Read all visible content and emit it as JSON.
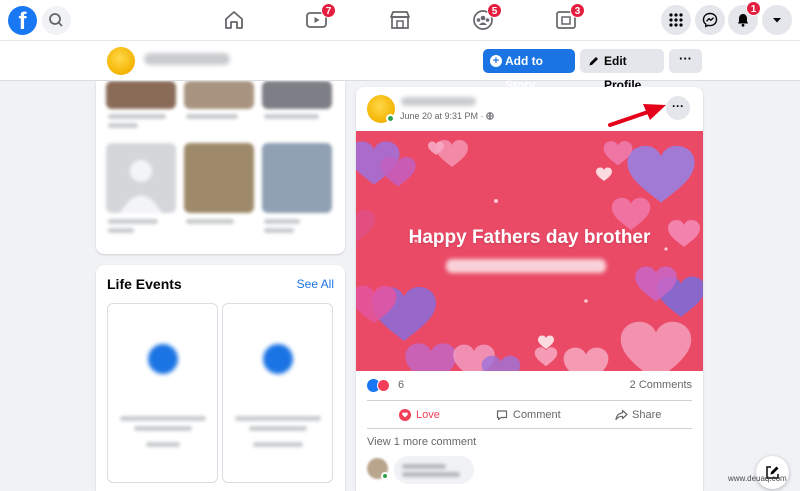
{
  "nav": {
    "watch_badge": "7",
    "groups_badge": "5",
    "gaming_badge": "3",
    "notifications_badge": "1"
  },
  "profile_bar": {
    "add_story": "Add to Story",
    "edit_profile": "Edit Profile",
    "more": "···"
  },
  "life_events": {
    "title": "Life Events",
    "see_all": "See All"
  },
  "post": {
    "date": "June 20 at 9:31 PM · ",
    "more": "···",
    "image_text": "Happy Fathers day brother",
    "reaction_count": "6",
    "comments": "2 Comments",
    "actions": {
      "love": "Love",
      "comment": "Comment",
      "share": "Share"
    },
    "view_more": "View 1 more comment"
  },
  "watermark": "www.deuaq.com",
  "colors": {
    "brand_blue": "#1877f2",
    "badge_red": "#e41e3f",
    "love_red": "#f33e58",
    "post_image_bg": "#ea4a66"
  }
}
